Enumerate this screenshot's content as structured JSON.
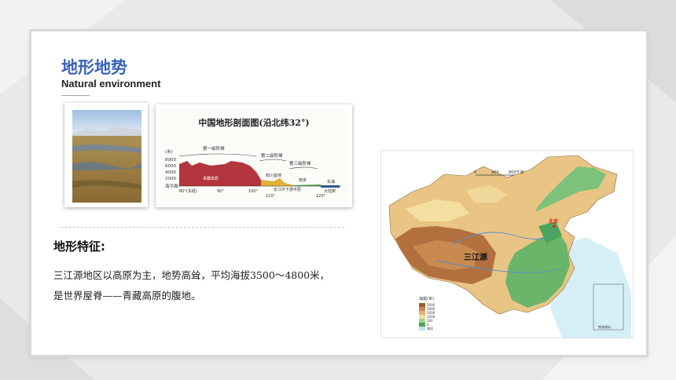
{
  "slide": {
    "title": "地形地势",
    "subtitle": "Natural environment",
    "feature_heading": "地形特征:",
    "feature_line1": "三江源地区以高原为主，地势高耸，平均海拔3500～4800米，",
    "feature_line2": "是世界屋脊——青藏高原的腹地。"
  },
  "profile_figure": {
    "title": "中国地形剖面图(沿北纬32°)",
    "unit": "(米)",
    "y_ticks": [
      "8000",
      "6000",
      "4000",
      "2000",
      "海平面"
    ],
    "x_ticks": [
      "80°(东经)",
      "90°",
      "100°",
      "110°",
      "120°"
    ],
    "steps": [
      "第一级阶梯",
      "第二级阶梯",
      "第三级阶梯"
    ],
    "places": [
      "喜马拉雅山脉",
      "横断山脉",
      "四川盆地",
      "南京",
      "东海",
      "青藏高原",
      "长江中下游平原",
      "大陆架"
    ]
  },
  "map_figure": {
    "scale_labels": [
      "0",
      "400",
      "800千米"
    ],
    "highlight_label": "三江源",
    "capital_label": "北京",
    "legend_title": "海拔(米)",
    "legend_items": [
      "5000",
      "3000",
      "2000",
      "1000",
      "500",
      "0",
      "海洋"
    ],
    "inset_label": "南海诸岛",
    "colors": {
      "high": "#b06b3a",
      "mid": "#e2b173",
      "low": "#f3dfa0",
      "plain": "#4aa65a",
      "sea": "#bfe3f0"
    }
  }
}
